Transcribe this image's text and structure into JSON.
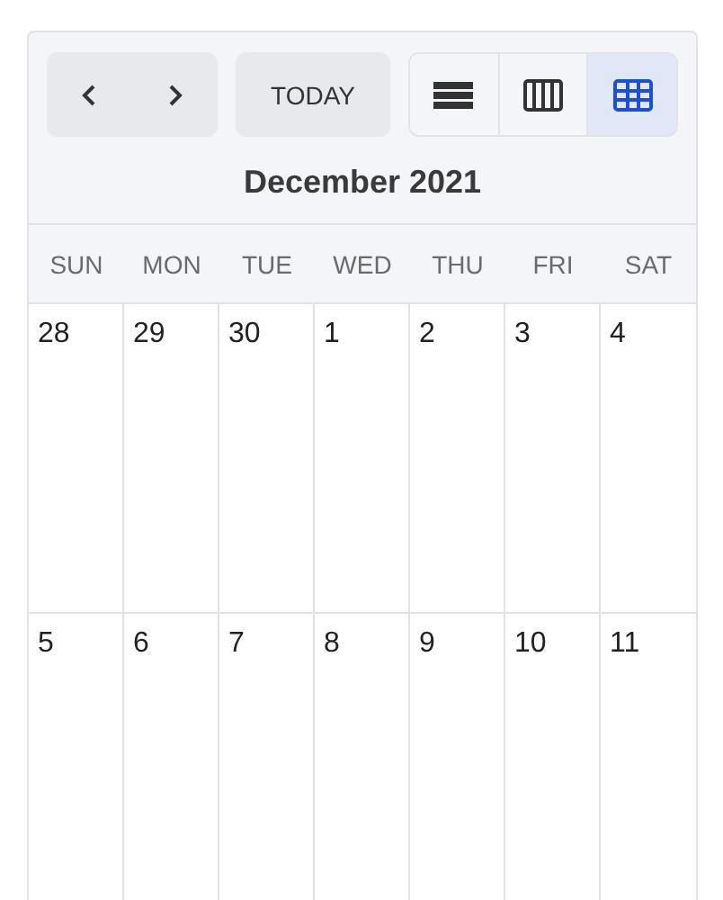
{
  "toolbar": {
    "today_label": "TODAY",
    "views": [
      {
        "kind": "list",
        "selected": false
      },
      {
        "kind": "week",
        "selected": false
      },
      {
        "kind": "month",
        "selected": true
      }
    ]
  },
  "title": "December 2021",
  "weekdays": [
    "SUN",
    "MON",
    "TUE",
    "WED",
    "THU",
    "FRI",
    "SAT"
  ],
  "weeks": [
    [
      "28",
      "29",
      "30",
      "1",
      "2",
      "3",
      "4"
    ],
    [
      "5",
      "6",
      "7",
      "8",
      "9",
      "10",
      "11"
    ]
  ]
}
